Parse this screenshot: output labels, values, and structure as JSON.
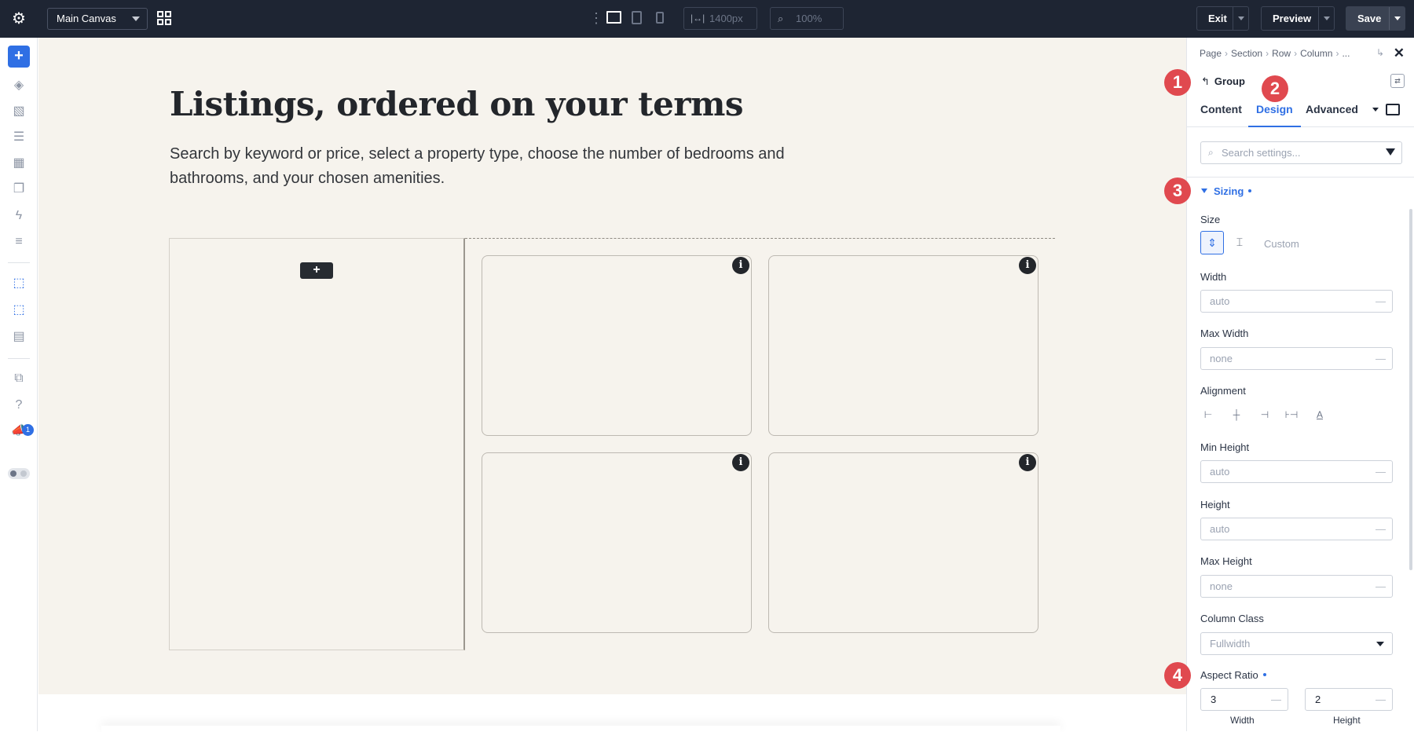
{
  "topbar": {
    "canvas_select": "Main Canvas",
    "width_value": "1400px",
    "zoom_value": "100%",
    "exit_label": "Exit",
    "preview_label": "Preview",
    "save_label": "Save"
  },
  "sidebar": {
    "notification_count": "1"
  },
  "canvas": {
    "heading": "Listings, ordered on your terms",
    "subtext": "Search by keyword or price, select a property type, choose the number of bedrooms and bathrooms, and your chosen amenities.",
    "add_label": "+",
    "info_glyph": "i"
  },
  "panel": {
    "breadcrumbs": [
      "Page",
      "Section",
      "Row",
      "Column",
      "..."
    ],
    "group_label": "Group",
    "tabs": [
      "Content",
      "Design",
      "Advanced"
    ],
    "active_tab": "Design",
    "search_placeholder": "Search settings...",
    "section_title": "Sizing",
    "size_label": "Size",
    "size_custom": "Custom",
    "width_label": "Width",
    "width_placeholder": "auto",
    "max_width_label": "Max Width",
    "max_width_placeholder": "none",
    "alignment_label": "Alignment",
    "min_height_label": "Min Height",
    "min_height_placeholder": "auto",
    "height_label": "Height",
    "height_placeholder": "auto",
    "max_height_label": "Max Height",
    "max_height_placeholder": "none",
    "column_class_label": "Column Class",
    "column_class_value": "Fullwidth",
    "aspect_ratio_label": "Aspect Ratio",
    "aspect_width_value": "3",
    "aspect_height_value": "2",
    "aspect_width_caption": "Width",
    "aspect_height_caption": "Height"
  },
  "badges": [
    "1",
    "2",
    "3",
    "4"
  ],
  "colors": {
    "accent": "#2f6fe4",
    "topbar": "#1e2533",
    "canvas_bg": "#f6f3ed",
    "badge": "#e0494f"
  }
}
